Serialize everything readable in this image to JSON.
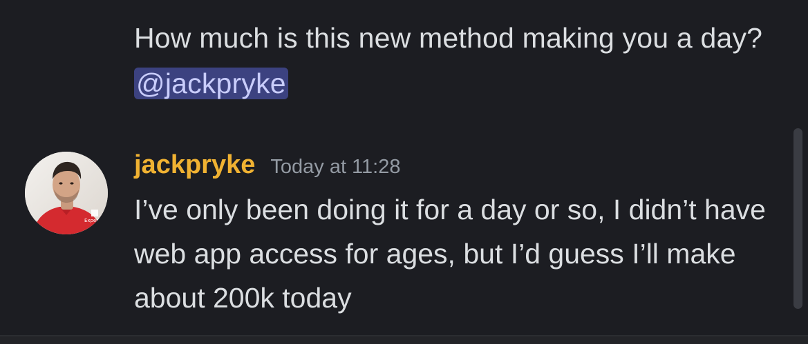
{
  "previous_message": {
    "text_before_mention": "How much is this new method making you a day? ",
    "mention": "@jackpryke"
  },
  "message": {
    "username": "jackpryke",
    "timestamp": "Today at 11:28",
    "avatar_icon": "user-avatar-photo",
    "body": "I’ve only been doing it for a day or so, I didn’t have web app access for ages, but I’d guess I’ll make about 200k today",
    "avatar_badge_text": "Expedi"
  },
  "colors": {
    "background": "#1c1d22",
    "text": "#dbdee1",
    "username": "#f0b232",
    "timestamp": "#949ba4",
    "mention_bg": "#3c4280",
    "mention_text": "#c9cdfb"
  }
}
